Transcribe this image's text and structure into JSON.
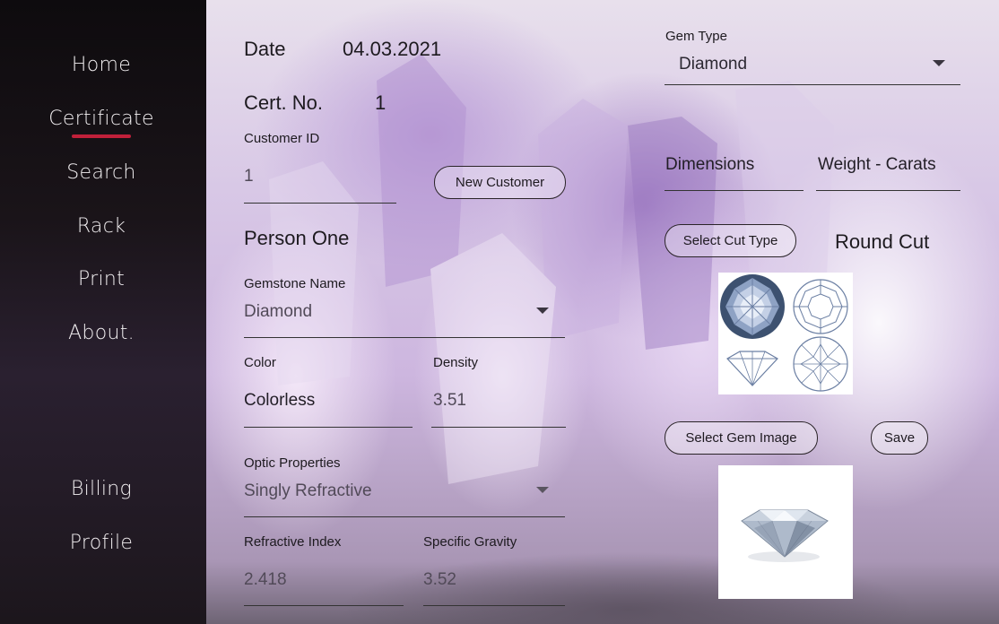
{
  "nav": {
    "items": [
      "Home",
      "Certificate",
      "Search",
      "Rack",
      "Print",
      "About."
    ],
    "bottom_items": [
      "Billing",
      "Profile"
    ],
    "active": "Certificate",
    "accent_color": "#c0203a"
  },
  "form": {
    "date_label": "Date",
    "date_value": "04.03.2021",
    "cert_label": "Cert. No.",
    "cert_value": "1",
    "customer_id_label": "Customer ID",
    "customer_id_value": "1",
    "new_customer_button": "New Customer",
    "customer_name": "Person One",
    "gemstone_name_label": "Gemstone Name",
    "gemstone_name_value": "Diamond",
    "color_label": "Color",
    "color_value": "Colorless",
    "density_label": "Density",
    "density_value": "3.51",
    "optic_label": "Optic Properties",
    "optic_value": "Singly Refractive",
    "ri_label": "Refractive Index",
    "ri_value": "2.418",
    "sg_label": "Specific Gravity",
    "sg_value": "3.52"
  },
  "right": {
    "gem_type_label": "Gem Type",
    "gem_type_value": "Diamond",
    "dimensions_label": "Dimensions",
    "weight_label": "Weight - Carats",
    "select_cut_button": "Select Cut Type",
    "cut_value": "Round Cut",
    "select_image_button": "Select Gem Image",
    "save_button": "Save"
  }
}
